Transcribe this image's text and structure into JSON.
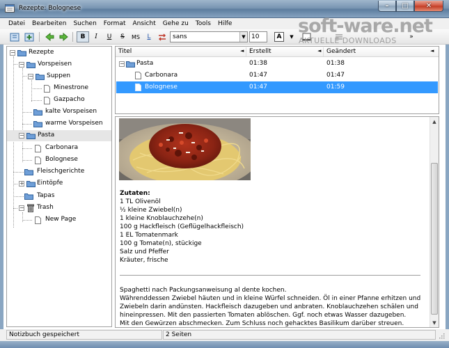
{
  "window": {
    "title": "Rezepte: Bolognese",
    "minimize_glyph": "–",
    "maximize_glyph": "□",
    "close_glyph": "✕"
  },
  "menu": [
    {
      "label": "Datei"
    },
    {
      "label": "Bearbeiten"
    },
    {
      "label": "Suchen"
    },
    {
      "label": "Format"
    },
    {
      "label": "Ansicht"
    },
    {
      "label": "Gehe zu"
    },
    {
      "label": "Tools"
    },
    {
      "label": "Hilfe"
    }
  ],
  "toolbar": {
    "bold_label": "B",
    "italic_label": "I",
    "underline_label": "U",
    "strike_label": "S",
    "monospace_label": "MS",
    "link_label": "L",
    "font_value": "sans",
    "size_value": "10",
    "text_color_label": "A",
    "overflow_label": "»"
  },
  "watermark": {
    "main": "soft-ware.net",
    "sub": "AKTUELLE DOWNLOADS"
  },
  "tree": {
    "items": [
      {
        "label": "Rezepte"
      },
      {
        "label": "Vorspeisen"
      },
      {
        "label": "Suppen"
      },
      {
        "label": "Minestrone"
      },
      {
        "label": "Gazpacho"
      },
      {
        "label": "kalte Vorspeisen"
      },
      {
        "label": "warme Vorspeisen"
      },
      {
        "label": "Pasta"
      },
      {
        "label": "Carbonara"
      },
      {
        "label": "Bolognese"
      },
      {
        "label": "Fleischgerichte"
      },
      {
        "label": "Eintöpfe"
      },
      {
        "label": "Tapas"
      },
      {
        "label": "Trash"
      },
      {
        "label": "New Page"
      }
    ]
  },
  "list": {
    "columns": [
      "Titel",
      "Erstellt",
      "Geändert"
    ],
    "rows": [
      {
        "title": "Pasta",
        "created": "01:38",
        "modified": "01:38"
      },
      {
        "title": "Carbonara",
        "created": "01:47",
        "modified": "01:47"
      },
      {
        "title": "Bolognese",
        "created": "01:47",
        "modified": "01:59"
      }
    ]
  },
  "editor": {
    "ingredients_heading": "Zutaten:",
    "ingredients": [
      "1 TL  Olivenöl",
      "½ kleine  Zwiebel(n)",
      "1 kleine  Knoblauchzehe(n)",
      "100 g  Hackfleisch (Geflügelhackfleisch)",
      "1 EL  Tomatenmark",
      "100 g  Tomate(n), stückige",
      "Salz und Pfeffer",
      "Kräuter, frische"
    ],
    "instructions": [
      "Spaghetti nach Packungsanweisung al dente kochen.",
      "Währenddessen Zwiebel häuten und in kleine Würfel schneiden. Öl in einer Pfanne erhitzen und",
      "Zwiebeln darin andünsten. Hackfleisch dazugeben und anbraten. Knoblauchzehen schälen und",
      "hineinpressen. Mit den passierten Tomaten ablöschen. Ggf. noch etwas Wasser dazugeben.",
      "Mit den Gewürzen abschmecken. Zum Schluss noch gehacktes Basilikum darüber streuen."
    ]
  },
  "status": {
    "left": "Notizbuch gespeichert",
    "middle": "2 Seiten"
  },
  "colors": {
    "selection": "#3399ff",
    "tree_selection": "#e6e6e6",
    "title_gradient_top": "#9fb6cc",
    "title_gradient_bottom": "#5d7e9f"
  }
}
